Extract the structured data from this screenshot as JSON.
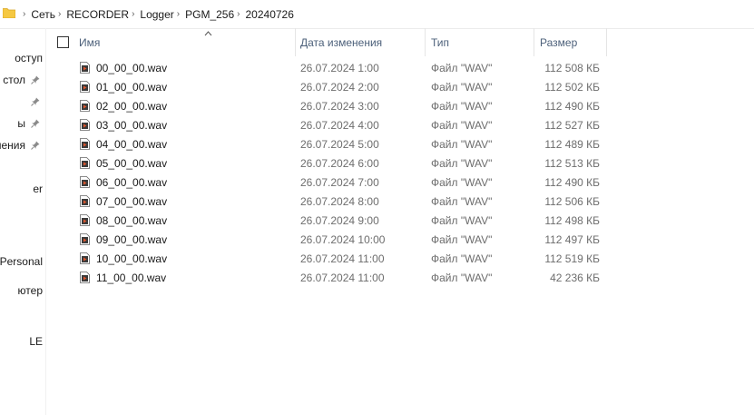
{
  "breadcrumb": [
    "Сеть",
    "RECORDER",
    "Logger",
    "PGM_256",
    "20240726"
  ],
  "nav": {
    "items": [
      {
        "label": "оступ",
        "pinned": false
      },
      {
        "label": "стол",
        "pinned": true
      },
      {
        "label": "",
        "pinned": true
      },
      {
        "label": "ы",
        "pinned": true
      },
      {
        "label": "нения",
        "pinned": true
      },
      {
        "label": "er",
        "pinned": false
      },
      {
        "label": "Personal",
        "pinned": false
      },
      {
        "label": "ютер",
        "pinned": false
      },
      {
        "label": "LE",
        "pinned": false
      }
    ]
  },
  "columns": {
    "name": "Имя",
    "date": "Дата изменения",
    "type": "Тип",
    "size": "Размер"
  },
  "files": [
    {
      "name": "00_00_00.wav",
      "date": "26.07.2024 1:00",
      "type": "Файл \"WAV\"",
      "size": "112 508 КБ"
    },
    {
      "name": "01_00_00.wav",
      "date": "26.07.2024 2:00",
      "type": "Файл \"WAV\"",
      "size": "112 502 КБ"
    },
    {
      "name": "02_00_00.wav",
      "date": "26.07.2024 3:00",
      "type": "Файл \"WAV\"",
      "size": "112 490 КБ"
    },
    {
      "name": "03_00_00.wav",
      "date": "26.07.2024 4:00",
      "type": "Файл \"WAV\"",
      "size": "112 527 КБ"
    },
    {
      "name": "04_00_00.wav",
      "date": "26.07.2024 5:00",
      "type": "Файл \"WAV\"",
      "size": "112 489 КБ"
    },
    {
      "name": "05_00_00.wav",
      "date": "26.07.2024 6:00",
      "type": "Файл \"WAV\"",
      "size": "112 513 КБ"
    },
    {
      "name": "06_00_00.wav",
      "date": "26.07.2024 7:00",
      "type": "Файл \"WAV\"",
      "size": "112 490 КБ"
    },
    {
      "name": "07_00_00.wav",
      "date": "26.07.2024 8:00",
      "type": "Файл \"WAV\"",
      "size": "112 506 КБ"
    },
    {
      "name": "08_00_00.wav",
      "date": "26.07.2024 9:00",
      "type": "Файл \"WAV\"",
      "size": "112 498 КБ"
    },
    {
      "name": "09_00_00.wav",
      "date": "26.07.2024 10:00",
      "type": "Файл \"WAV\"",
      "size": "112 497 КБ"
    },
    {
      "name": "10_00_00.wav",
      "date": "26.07.2024 11:00",
      "type": "Файл \"WAV\"",
      "size": "112 519 КБ"
    },
    {
      "name": "11_00_00.wav",
      "date": "26.07.2024 11:00",
      "type": "Файл \"WAV\"",
      "size": "42 236 КБ"
    }
  ],
  "icons": {
    "folder": "folder-icon",
    "separator": "chevron-right-icon",
    "pin": "pin-icon",
    "file": "wav-file-icon",
    "sort": "sort-ascending-icon"
  },
  "colors": {
    "header_text": "#4c607a",
    "folder": "#f5c842",
    "file_icon": "#b03a2e"
  }
}
